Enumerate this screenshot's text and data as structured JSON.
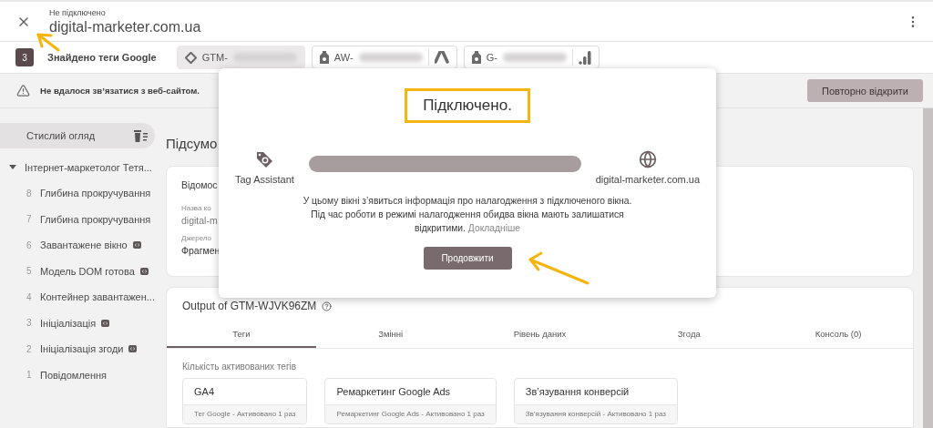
{
  "header": {
    "status": "Не підключено",
    "domain": "digital-marketer.com.ua"
  },
  "tag_bar": {
    "count": "3",
    "label": "Знайдено теги Google",
    "tags": [
      {
        "kind": "gtm",
        "prefix": "GTM-",
        "selected": true
      },
      {
        "kind": "ads",
        "prefix": "AW-",
        "selected": false
      },
      {
        "kind": "analytics",
        "prefix": "G-",
        "selected": false
      }
    ]
  },
  "warning": {
    "message": "Не вдалося зв’язатися з веб-сайтом.",
    "button": "Повторно відкрити"
  },
  "sidebar": {
    "summary": {
      "label": "Стислий огляд",
      "selected": true
    },
    "tree": [
      {
        "label": "Інтернет-маркетолог Тетя...",
        "expanded": true,
        "children": [
          {
            "number": "8",
            "label": "Глибина прокручування",
            "badge": false
          },
          {
            "number": "7",
            "label": "Глибина прокручування",
            "badge": false
          },
          {
            "number": "6",
            "label": "Завантажене вікно",
            "badge": true
          },
          {
            "number": "5",
            "label": "Модель DOM готова",
            "badge": true
          },
          {
            "number": "4",
            "label": "Контейнер завантажен...",
            "badge": false
          },
          {
            "number": "3",
            "label": "Ініціалізація",
            "badge": true
          },
          {
            "number": "2",
            "label": "Ініціалізація згоди",
            "badge": true
          },
          {
            "number": "1",
            "label": "Повідомлення",
            "badge": false
          }
        ]
      }
    ]
  },
  "summary": {
    "heading": "Підсумо",
    "info_card": {
      "title": "Відомос",
      "fields": [
        {
          "label": "Назва ко",
          "value": "digital-m"
        },
        {
          "label": "Джерело",
          "value": "Фрагмен"
        }
      ]
    }
  },
  "output": {
    "title": "Output of GTM-WJVK96ZM",
    "tabs": [
      {
        "label": "Теги",
        "selected": true
      },
      {
        "label": "Змінні",
        "selected": false
      },
      {
        "label": "Рівень даних",
        "selected": false
      },
      {
        "label": "Згода",
        "selected": false
      },
      {
        "label": "Консоль (0)",
        "selected": false
      }
    ],
    "section_label": "Кількість активованих тегів",
    "tag_cards": [
      {
        "name": "GA4",
        "detail": "Тег Google - Активовано 1 раз"
      },
      {
        "name": "Ремаркетинг Google Ads",
        "detail": "Ремаркетинг Google Ads - Активовано 1 раз"
      },
      {
        "name": "Зв’язування конверсій",
        "detail": "Зв’язування конверсій - Активовано 1 раз"
      }
    ]
  },
  "dialog": {
    "title": "Підключено.",
    "source": "Tag Assistant",
    "target": "digital-marketer.com.ua",
    "message": "У цьому вікні з’явиться інформація про налагодження з підключеного вікна. Під час роботи в режимі налагодження обидва вікна мають залишатися відкритими.",
    "link": "Докладніше",
    "button": "Продовжити"
  }
}
